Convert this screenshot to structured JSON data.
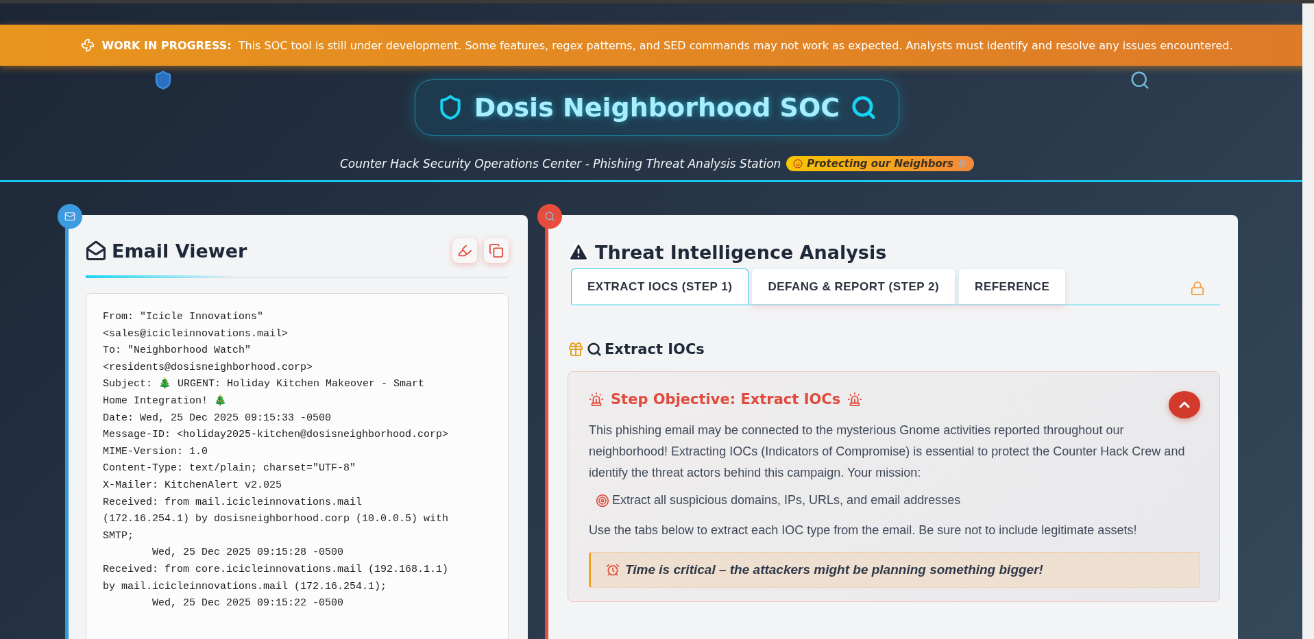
{
  "banner": {
    "label": "WORK IN PROGRESS:",
    "message": "This SOC tool is still under development. Some features, regex patterns, and SED commands may not work as expected. Analysts must identify and resolve any issues encountered."
  },
  "header": {
    "title": "Dosis Neighborhood SOC",
    "subtitle": "Counter Hack Security Operations Center - Phishing Threat Analysis Station",
    "badge": "Protecting our Neighbors"
  },
  "email_panel": {
    "title": "Email Viewer",
    "lines": [
      "From: \"Icicle Innovations\"",
      "<sales@icicleinnovations.mail>",
      "To: \"Neighborhood Watch\"",
      "<residents@dosisneighborhood.corp>",
      "Subject: 🎄 URGENT: Holiday Kitchen Makeover - Smart",
      "Home Integration! 🎄",
      "Date: Wed, 25 Dec 2025 09:15:33 -0500",
      "Message-ID: <holiday2025-kitchen@dosisneighborhood.corp>",
      "MIME-Version: 1.0",
      "Content-Type: text/plain; charset=\"UTF-8\"",
      "X-Mailer: KitchenAlert v2.025",
      "Received: from mail.icicleinnovations.mail",
      "(172.16.254.1) by dosisneighborhood.corp (10.0.0.5) with",
      "SMTP;",
      "        Wed, 25 Dec 2025 09:15:28 -0500",
      "Received: from core.icicleinnovations.mail (192.168.1.1)",
      "by mail.icicleinnovations.mail (172.16.254.1);",
      "        Wed, 25 Dec 2025 09:15:22 -0500"
    ]
  },
  "analysis_panel": {
    "title": "Threat Intelligence Analysis",
    "tabs": [
      {
        "label": "EXTRACT IOCS (STEP 1)",
        "selected": true
      },
      {
        "label": "DEFANG & REPORT (STEP 2)",
        "selected": false
      },
      {
        "label": "REFERENCE",
        "selected": false
      }
    ],
    "locked": true,
    "section_title": "Extract IOCs",
    "objective": {
      "title": "Step Objective: Extract IOCs",
      "expanded": true,
      "intro": "This phishing email may be connected to the mysterious Gnome activities reported throughout our neighborhood! Extracting IOCs (Indicators of Compromise) is essential to protect the Counter Hack Crew and identify the threat actors behind this campaign. Your mission:",
      "bullet": "Extract all suspicious domains, IPs, URLs, and email addresses",
      "instruction": "Use the tabs below to extract each IOC type from the email. Be sure not to include legitimate assets!",
      "warning": "Time is critical – the attackers might be planning something bigger!"
    }
  }
}
